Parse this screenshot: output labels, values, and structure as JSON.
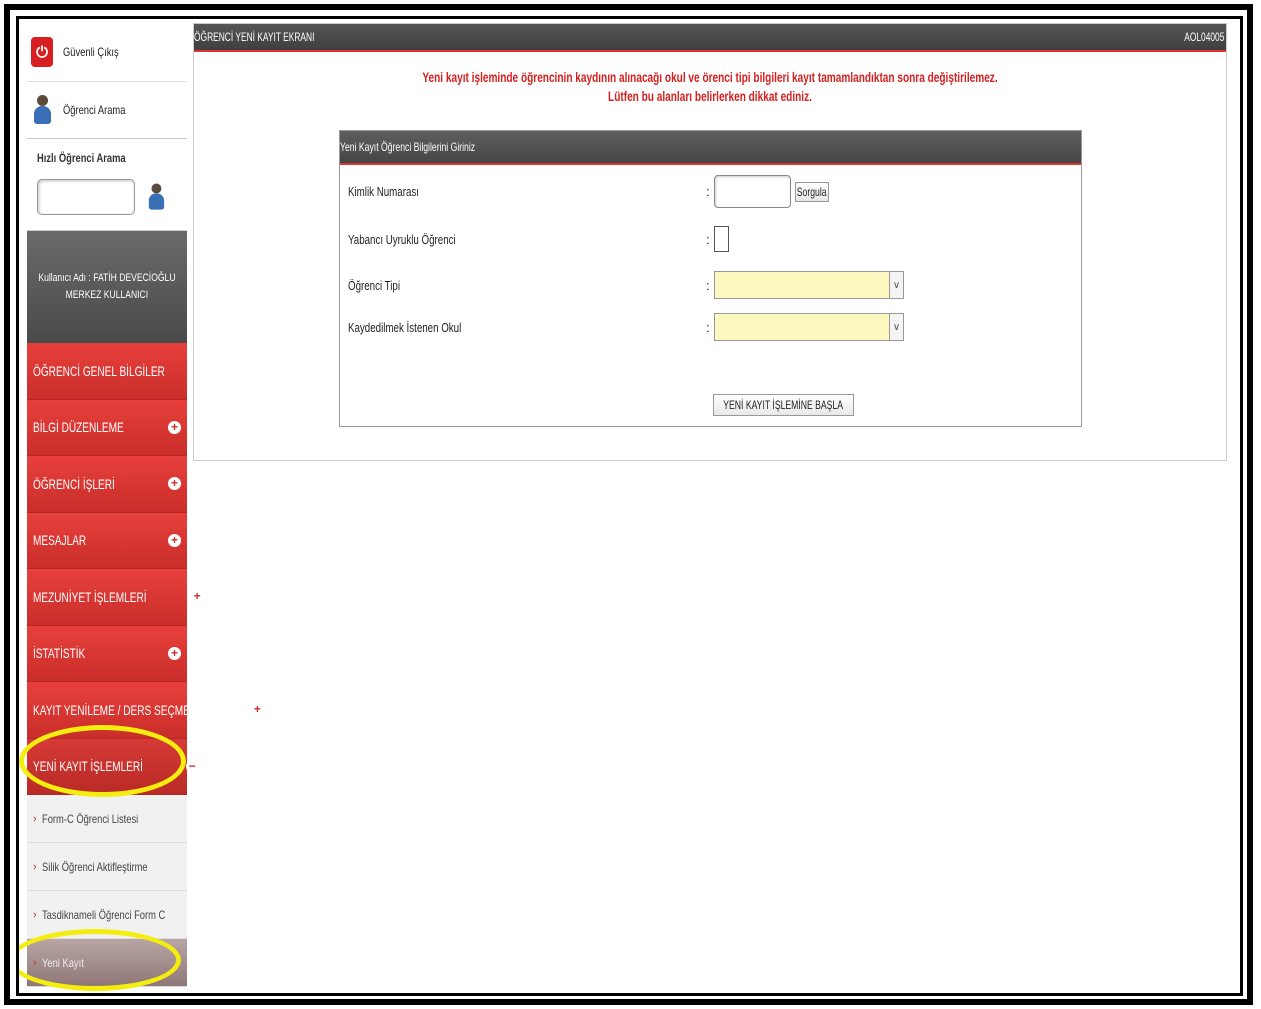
{
  "sidebar": {
    "logout_label": "Güvenli Çıkış",
    "search_student_label": "Öğrenci Arama",
    "quick_search_title": "Hızlı Öğrenci Arama",
    "quick_search_value": "",
    "user_line1": "Kullanıcı Adı : FATİH DEVECİOĞLU",
    "user_line2": "MERKEZ KULLANICI",
    "menu": [
      {
        "label": "ÖĞRENCİ GENEL BİLGİLER",
        "icon": "plus-icon",
        "active": false
      },
      {
        "label": "BİLGİ DÜZENLEME",
        "icon": "plus-icon",
        "active": false
      },
      {
        "label": "ÖĞRENCİ İŞLERİ",
        "icon": "plus-icon",
        "active": false
      },
      {
        "label": "MESAJLAR",
        "icon": "plus-icon",
        "active": false
      },
      {
        "label": "MEZUNİYET İŞLEMLERİ",
        "icon": "plus-icon",
        "active": false
      },
      {
        "label": "İSTATİSTİK",
        "icon": "plus-icon",
        "active": false
      },
      {
        "label": "KAYIT YENİLEME / DERS SEÇME",
        "icon": "plus-icon",
        "active": false
      },
      {
        "label": "YENİ KAYIT İŞLEMLERİ",
        "icon": "minus-icon",
        "active": true
      }
    ],
    "submenu": [
      {
        "label": "Form-C Öğrenci Listesi",
        "selected": false
      },
      {
        "label": "Silik Öğrenci Aktifleştirme",
        "selected": false
      },
      {
        "label": "Tasdiknameli Öğrenci Form C",
        "selected": false
      },
      {
        "label": "Yeni Kayıt",
        "selected": true
      }
    ]
  },
  "header": {
    "title": "ÖĞRENCİ YENİ KAYIT EKRANI",
    "code": "AOL04005"
  },
  "warning": {
    "line1": "Yeni kayıt işleminde öğrencinin kaydının alınacağı okul ve örenci tipi bilgileri kayıt tamamlandıktan sonra değiştirilemez.",
    "line2": "Lütfen bu alanları belirlerken dikkat ediniz."
  },
  "form": {
    "panel_title": "Yeni Kayıt Öğrenci Bilgilerini Giriniz",
    "kimlik_label": "Kimlik Numarası",
    "kimlik_value": "",
    "sorgula_label": "Sorgula",
    "yabanci_label": "Yabancı Uyruklu Öğrenci",
    "ogrenci_tipi_label": "Öğrenci Tipi",
    "ogrenci_tipi_value": "",
    "okul_label": "Kaydedilmek İstenen Okul",
    "okul_value": "",
    "colon": ":",
    "start_button": "YENİ KAYIT İŞLEMİNE BAŞLA"
  },
  "colors": {
    "accent_red": "#c92e2a",
    "header_dark": "#4a4a4a",
    "highlight_yellow": "#f3ee10",
    "select_bg": "#fdf7c0"
  }
}
